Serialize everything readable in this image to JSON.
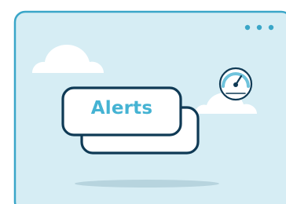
{
  "card": {
    "title": "Alerts"
  },
  "window": {
    "menu_icon": "three-dots-icon"
  },
  "decor": {
    "icons": [
      "cloud-icon",
      "speedometer-icon",
      "cloud-icon"
    ]
  },
  "colors": {
    "window_fill": "#d6edf4",
    "window_border": "#3aa6c8",
    "card_fill": "#ffffff",
    "card_border": "#0f3a55",
    "accent_text": "#45b3d3",
    "dot": "#3aa6c8",
    "shadow": "#9fc0cc"
  }
}
